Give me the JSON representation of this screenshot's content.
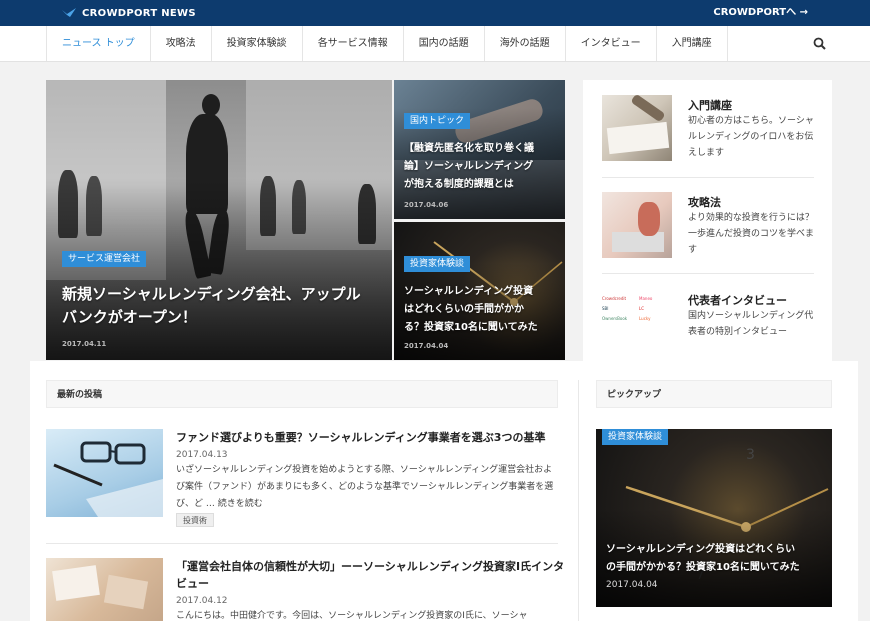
{
  "header": {
    "brand": "CROWDPORT NEWS",
    "external_link": "CROWDPORTへ →"
  },
  "nav": {
    "items": [
      {
        "label": "ニュース トップ",
        "active": true
      },
      {
        "label": "攻略法"
      },
      {
        "label": "投資家体験談"
      },
      {
        "label": "各サービス情報"
      },
      {
        "label": "国内の話題"
      },
      {
        "label": "海外の話題"
      },
      {
        "label": "インタビュー"
      },
      {
        "label": "入門講座"
      }
    ],
    "search_icon": "search-icon"
  },
  "hero": {
    "main": {
      "badge": "サービス運営会社",
      "title_line1": "新規ソーシャルレンディング会社、アップル",
      "title_line2": "バンクがオープン！",
      "date": "2017.04.11"
    },
    "top": {
      "badge": "国内トピック",
      "title_line1": "【融資先匿名化を取り巻く議",
      "title_line2": "論】ソーシャルレンディング",
      "title_line3": "が抱える制度的課題とは",
      "date": "2017.04.06"
    },
    "bottom": {
      "badge": "投資家体験談",
      "title_line1": "ソーシャルレンディング投資",
      "title_line2": "はどれくらいの手間がかか",
      "title_line3": "る？投資家10名に聞いてみた",
      "date": "2017.04.04"
    }
  },
  "sidebar": {
    "items": [
      {
        "title": "入門講座",
        "desc": "初心者の方はこちら。ソーシャルレンディングのイロハをお伝えします"
      },
      {
        "title": "攻略法",
        "desc": "より効果的な投資を行うには？一歩進んだ投資のコツを学べます"
      },
      {
        "title": "代表者インタビュー",
        "desc": "国内ソーシャルレンディング代表者の特別インタビュー"
      }
    ],
    "logos": [
      "Crowdcredit",
      "Maneo",
      "SBI",
      "LC",
      "OwnersBook",
      "Lucky"
    ]
  },
  "latest": {
    "heading": "最新の投稿",
    "posts": [
      {
        "title": "ファンド選びよりも重要？ソーシャルレンディング事業者を選ぶ3つの基準",
        "date": "2017.04.13",
        "excerpt": "いざソーシャルレンディング投資を始めようとする際、ソーシャルレンディング運営会社および案件（ファンド）があまりにも多く、どのような基準でソーシャルレンディング事業者を選び、ど … 続きを読む",
        "tag": "投資術"
      },
      {
        "title_line1": "「運営会社自体の信頼性が大切」ーーソーシャルレンディング投資家I氏インタ",
        "title_line2": "ビュー",
        "date": "2017.04.12",
        "excerpt": "こんにちは。中田健介です。今回は、ソーシャルレンディング投資家のI氏に、ソーシャ"
      }
    ]
  },
  "pickup": {
    "heading": "ピックアップ",
    "badge": "投資家体験談",
    "title_line1": "ソーシャルレンディング投資はどれくらい",
    "title_line2": "の手間がかかる？投資家10名に聞いてみた",
    "date": "2017.04.04"
  }
}
